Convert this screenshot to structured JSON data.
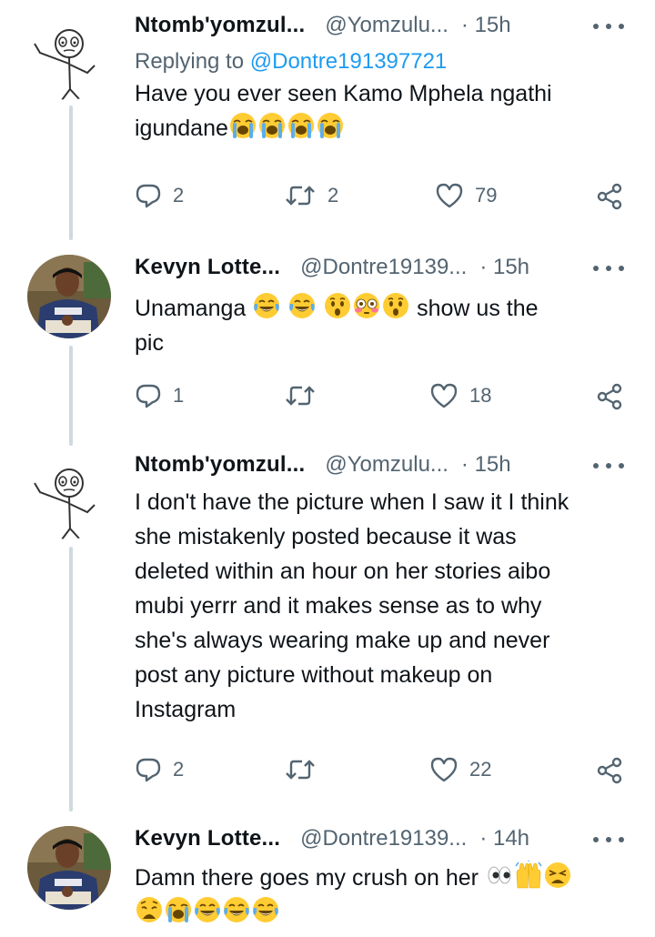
{
  "tweets": [
    {
      "name": "Ntomb'yomzul...",
      "handle": "@Yomzulu...",
      "time": "· 15h",
      "replying_label": "Replying to ",
      "replying_to": "@Dontre191397721",
      "text_lines": [
        "Have you ever seen Kamo Mphela ngathi",
        "igundane"
      ],
      "emojis_line2": [
        "loudly-crying-face",
        "loudly-crying-face",
        "loudly-crying-face",
        "loudly-crying-face"
      ],
      "replies": "2",
      "retweets": "2",
      "likes": "79",
      "avatar": "stick-figure-drawing"
    },
    {
      "name": "Kevyn Lotte...",
      "handle": "@Dontre19139...",
      "time": "· 15h",
      "text_start": "Unamanga",
      "text_end": "show us the",
      "text_line2": "pic",
      "emojis": [
        "face-with-tears-of-joy",
        "face-with-tears-of-joy",
        "hushed-face",
        "flushed-face",
        "hushed-face"
      ],
      "replies": "1",
      "retweets": "",
      "likes": "18",
      "avatar": "man-photo"
    },
    {
      "name": "Ntomb'yomzul...",
      "handle": "@Yomzulu...",
      "time": "· 15h",
      "text_lines": [
        "I don't have the picture when I saw it I think",
        "she mistakenly posted because it was",
        "deleted within an hour on her stories aibo",
        "mubi yerrr and it makes sense as to why",
        "she's always wearing make up and never",
        "post any picture without makeup on",
        "Instagram"
      ],
      "replies": "2",
      "retweets": "",
      "likes": "22",
      "avatar": "stick-figure-drawing"
    },
    {
      "name": "Kevyn Lotte...",
      "handle": "@Dontre19139...",
      "time": "· 14h",
      "text_line1": "Damn there goes my crush on her",
      "emojis_line1": [
        "eyes",
        "raising-hands",
        "tired-face"
      ],
      "emojis_line2": [
        "weary-face",
        "loudly-crying-face",
        "face-with-tears-of-joy",
        "face-with-tears-of-joy",
        "face-with-tears-of-joy"
      ],
      "avatar": "man-photo"
    }
  ],
  "colors": {
    "secondary_text": "#536471",
    "link": "#1d9bf0",
    "thread_line": "#cfd9de",
    "emoji_yellow": "#ffcc33"
  }
}
